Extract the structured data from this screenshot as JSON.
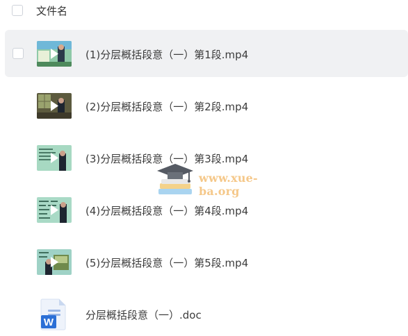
{
  "header": {
    "column_title": "文件名"
  },
  "files": [
    {
      "name": "(1)分层概括段意（一）第1段.mp4",
      "type": "video",
      "hovered": true
    },
    {
      "name": "(2)分层概括段意（一）第2段.mp4",
      "type": "video",
      "hovered": false
    },
    {
      "name": "(3)分层概括段意（一）第3段.mp4",
      "type": "video",
      "hovered": false
    },
    {
      "name": "(4)分层概括段意（一）第4段.mp4",
      "type": "video",
      "hovered": false
    },
    {
      "name": "(5)分层概括段意（一）第5段.mp4",
      "type": "video",
      "hovered": false
    },
    {
      "name": "分层概括段意（一）.doc",
      "type": "word-doc",
      "hovered": false
    }
  ],
  "watermark": {
    "text": "www.xue-ba.org",
    "icon": "graduation-cap-books-icon"
  },
  "colors": {
    "hover_row": "#f0f1f3",
    "word_blue": "#2b6fd6",
    "watermark_orange": "#f5c88a"
  }
}
